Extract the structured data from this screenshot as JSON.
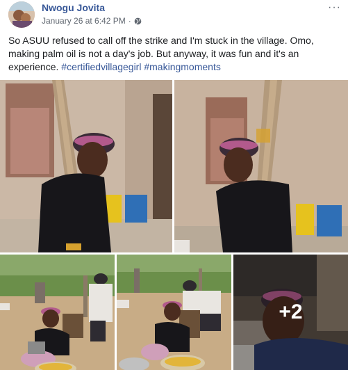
{
  "post": {
    "author": "Nwogu Jovita",
    "timestamp": "January 26 at 6:42 PM",
    "separator": "·",
    "privacy_icon": "globe-icon",
    "more_icon": "ellipsis-icon",
    "more_label": "···",
    "text_body": "So ASUU refused to call off the strike and I'm stuck in the village. Omo, making palm oil is not a day's job. But anyway, it was fun and it's an experience. ",
    "hashtags": [
      "#certifiedvillagegirl",
      "#makingmoments"
    ]
  },
  "photos": {
    "extra_count": "+2"
  },
  "colors": {
    "link": "#385898",
    "text": "#1c1e21",
    "meta": "#606770"
  }
}
